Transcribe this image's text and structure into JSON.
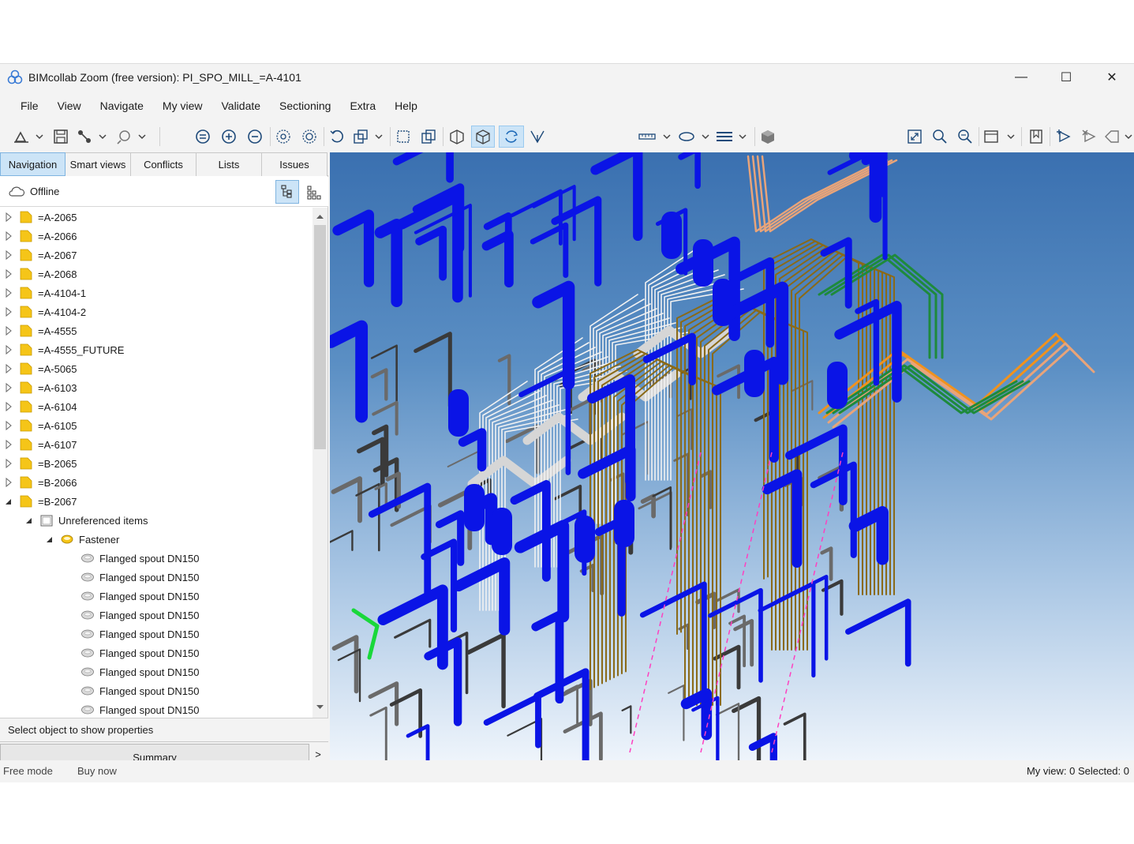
{
  "window": {
    "title": "BIMcollab Zoom (free version): PI_SPO_MILL_=A-4101",
    "controls": {
      "minimize": "—",
      "maximize": "☐",
      "close": "✕"
    }
  },
  "menu": [
    "File",
    "View",
    "Navigate",
    "My view",
    "Validate",
    "Sectioning",
    "Extra",
    "Help"
  ],
  "toolbar": {
    "icons": [
      "open-icon",
      "save-icon",
      "share-icon",
      "link-icon",
      "zoom-fit-icon",
      "zoom-in-icon",
      "zoom-out-icon",
      "orbit-icon",
      "walk-icon",
      "undo-view-icon",
      "view-select-icon",
      "box-icon",
      "copy-icon",
      "section-icon",
      "cube-icon",
      "rotate-icon",
      "fly-icon",
      "measure-icon",
      "ellipse-icon",
      "lines-icon",
      "render-icon",
      "fullscreen-icon",
      "search-icon",
      "find-icon",
      "display-icon",
      "bookmark-icon",
      "issue-add-icon",
      "issue-remove-icon",
      "tag-icon"
    ]
  },
  "tabs": [
    "Navigation",
    "Smart views",
    "Conflicts",
    "Lists",
    "Issues"
  ],
  "active_tab": "Navigation",
  "offline_label": "Offline",
  "tree": [
    {
      "label": "=A-2065",
      "type": "folder",
      "expanded": false,
      "level": 0
    },
    {
      "label": "=A-2066",
      "type": "folder",
      "expanded": false,
      "level": 0
    },
    {
      "label": "=A-2067",
      "type": "folder",
      "expanded": false,
      "level": 0
    },
    {
      "label": "=A-2068",
      "type": "folder",
      "expanded": false,
      "level": 0
    },
    {
      "label": "=A-4104-1",
      "type": "folder",
      "expanded": false,
      "level": 0
    },
    {
      "label": "=A-4104-2",
      "type": "folder",
      "expanded": false,
      "level": 0
    },
    {
      "label": "=A-4555",
      "type": "folder",
      "expanded": false,
      "level": 0
    },
    {
      "label": "=A-4555_FUTURE",
      "type": "folder",
      "expanded": false,
      "level": 0
    },
    {
      "label": "=A-5065",
      "type": "folder",
      "expanded": false,
      "level": 0
    },
    {
      "label": "=A-6103",
      "type": "folder",
      "expanded": false,
      "level": 0
    },
    {
      "label": "=A-6104",
      "type": "folder",
      "expanded": false,
      "level": 0
    },
    {
      "label": "=A-6105",
      "type": "folder",
      "expanded": false,
      "level": 0
    },
    {
      "label": "=A-6107",
      "type": "folder",
      "expanded": false,
      "level": 0
    },
    {
      "label": "=B-2065",
      "type": "folder",
      "expanded": false,
      "level": 0
    },
    {
      "label": "=B-2066",
      "type": "folder",
      "expanded": false,
      "level": 0
    },
    {
      "label": "=B-2067",
      "type": "folder",
      "expanded": true,
      "level": 0
    },
    {
      "label": "Unreferenced items",
      "type": "group",
      "expanded": true,
      "level": 1
    },
    {
      "label": "Fastener",
      "type": "category",
      "expanded": true,
      "level": 2
    },
    {
      "label": "Flanged spout DN150",
      "type": "item",
      "level": 3
    },
    {
      "label": "Flanged spout DN150",
      "type": "item",
      "level": 3
    },
    {
      "label": "Flanged spout DN150",
      "type": "item",
      "level": 3
    },
    {
      "label": "Flanged spout DN150",
      "type": "item",
      "level": 3
    },
    {
      "label": "Flanged spout DN150",
      "type": "item",
      "level": 3
    },
    {
      "label": "Flanged spout DN150",
      "type": "item",
      "level": 3
    },
    {
      "label": "Flanged spout DN150",
      "type": "item",
      "level": 3
    },
    {
      "label": "Flanged spout DN150",
      "type": "item",
      "level": 3
    },
    {
      "label": "Flanged spout DN150",
      "type": "item",
      "level": 3
    }
  ],
  "properties_hint": "Select object to show properties",
  "summary_label": "Summary",
  "summary_arrow": ">",
  "status": {
    "mode": "Free mode",
    "buy": "Buy now",
    "counts": "My view: 0  Selected: 0"
  },
  "colors": {
    "accent": "#cce4f7",
    "folder": "#f5c518",
    "pipe_blue": "#0a14e6",
    "pipe_brown": "#8a6a18",
    "pipe_orange": "#f0921e",
    "pipe_green": "#1e8a3c",
    "pipe_white": "#f2f2f2"
  }
}
